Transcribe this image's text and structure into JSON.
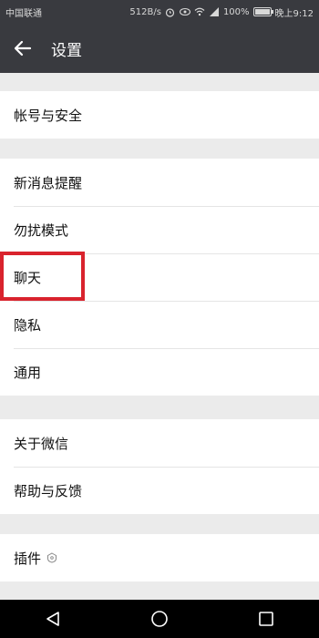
{
  "status_bar": {
    "carrier": "中国联通",
    "speed": "512B/s",
    "battery": "100%",
    "battery_level": 1.0,
    "time": "晚上9:12"
  },
  "header": {
    "title": "设置",
    "back_icon": "arrow-left-icon"
  },
  "groups": [
    {
      "items": [
        "帐号与安全"
      ]
    },
    {
      "items": [
        "新消息提醒",
        "勿扰模式",
        "聊天",
        "隐私",
        "通用"
      ]
    },
    {
      "items": [
        "关于微信",
        "帮助与反馈"
      ]
    },
    {
      "items": [
        "插件"
      ]
    }
  ],
  "highlighted_item": "聊天",
  "accent_color": "#d9232d",
  "nav_bar": {
    "buttons": [
      "back-triangle-icon",
      "home-circle-icon",
      "recents-square-icon"
    ]
  }
}
